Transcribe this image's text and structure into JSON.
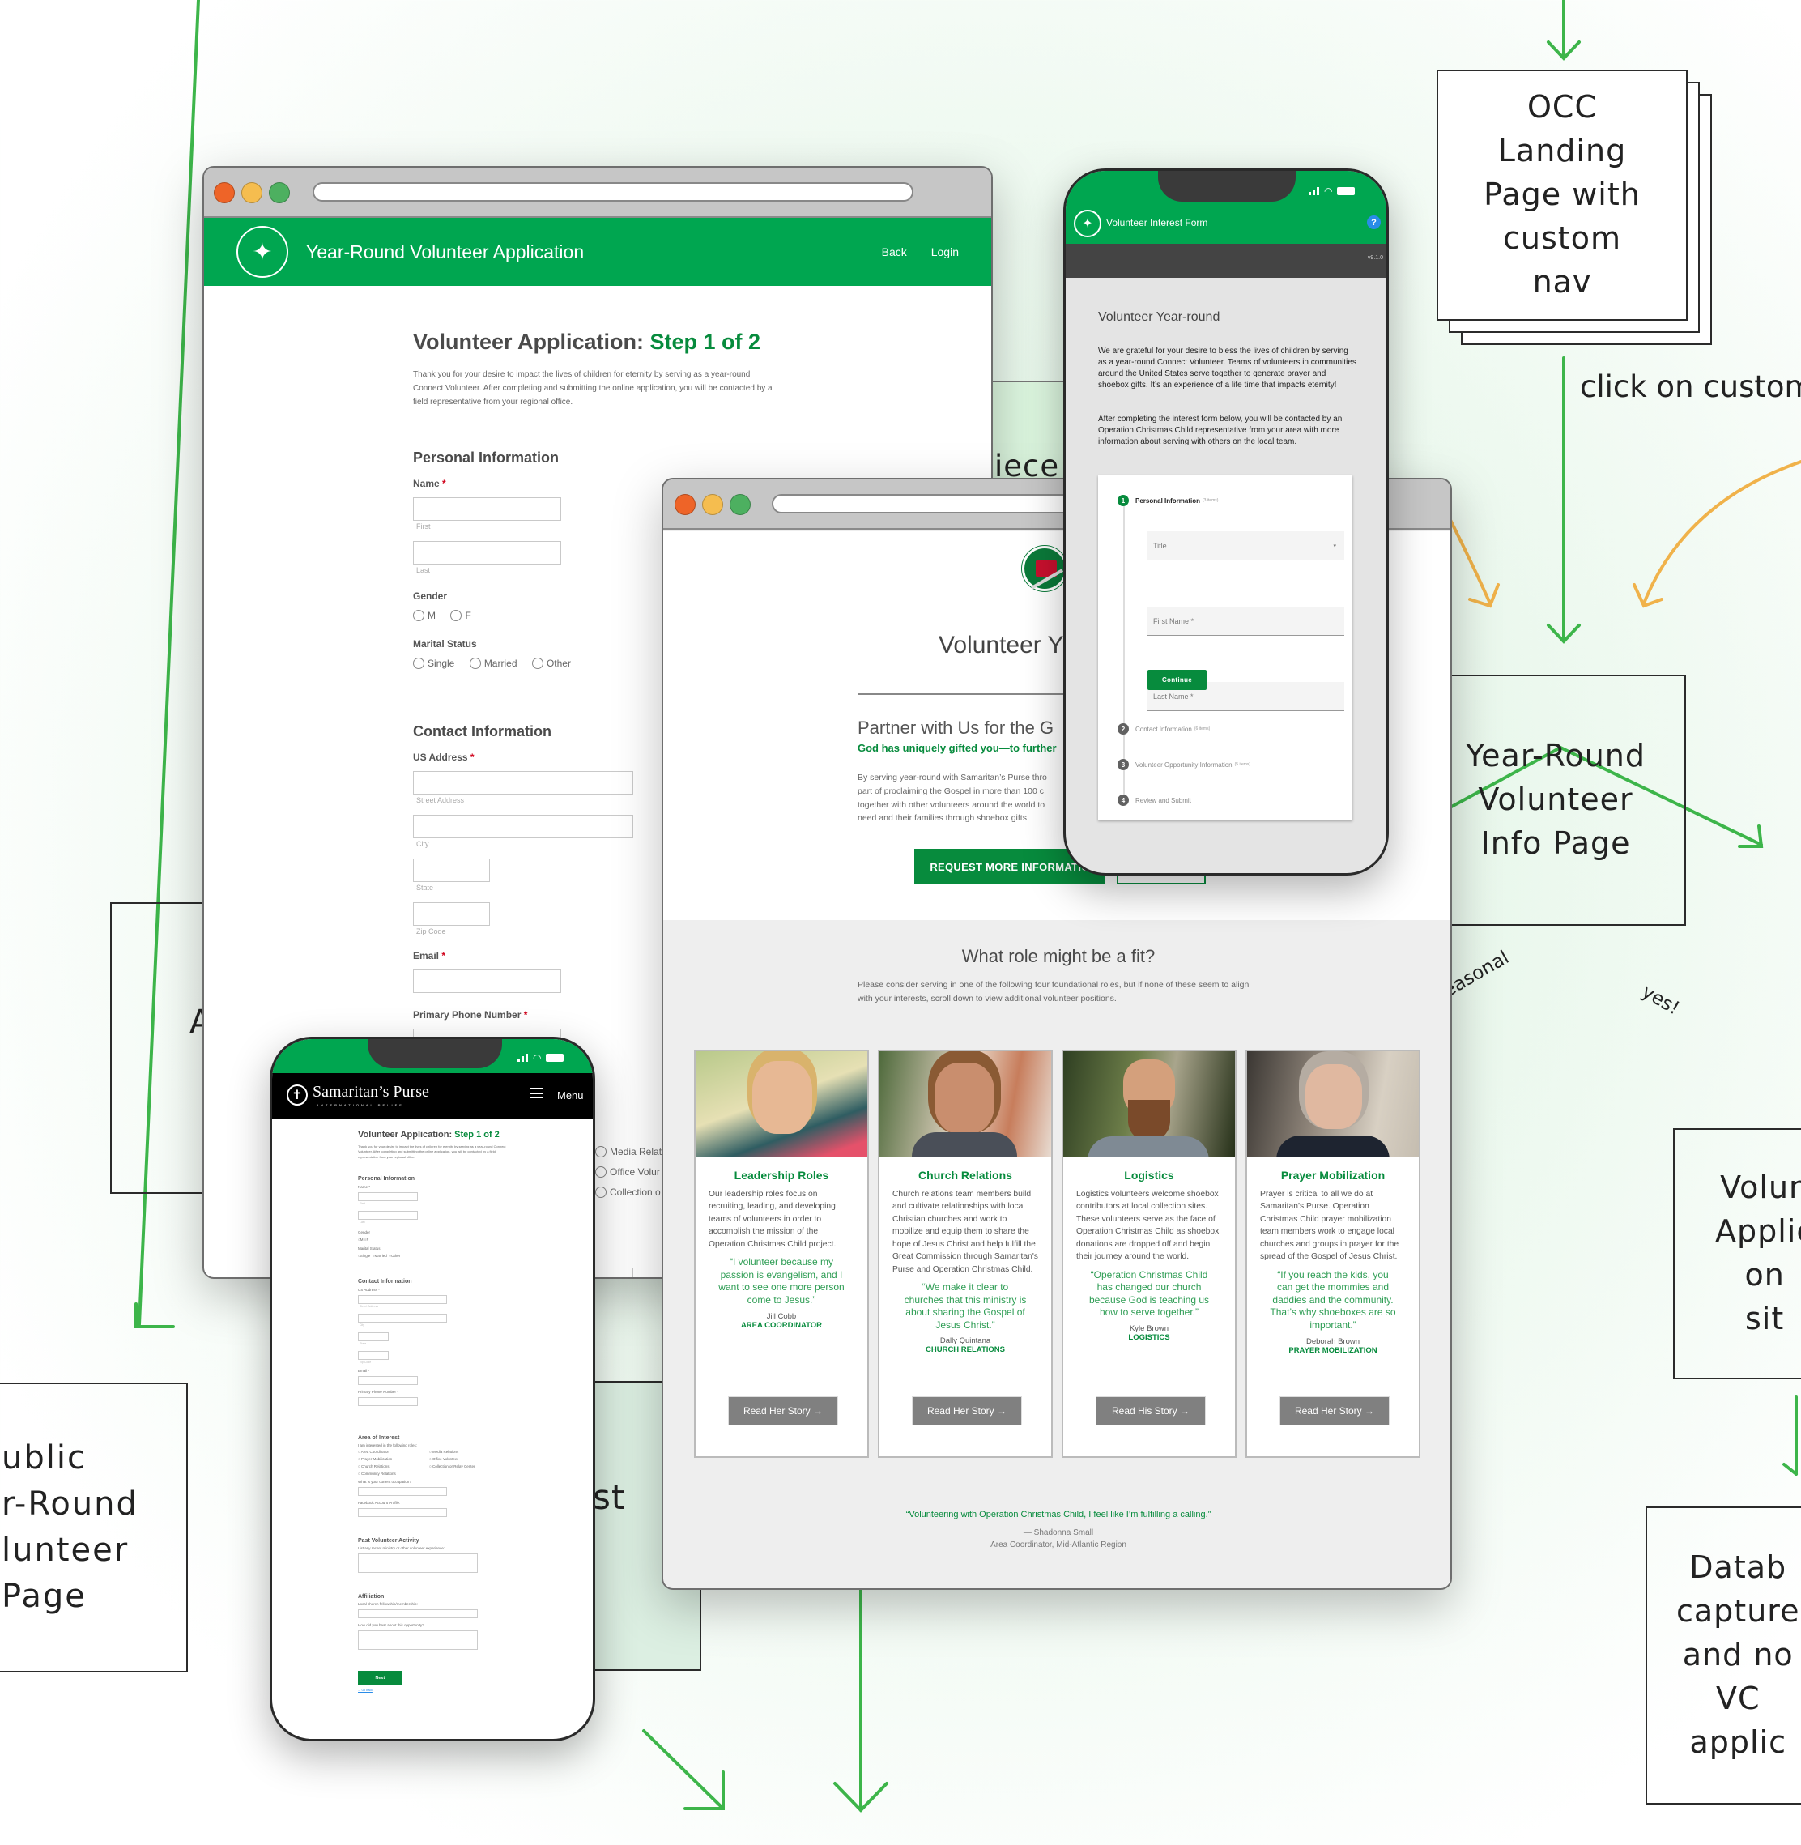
{
  "flow": {
    "occ_landing": "OCC\nLanding\nPage with\ncustom\nnav",
    "click_label": "click on custom",
    "info_page": "Year-Round\nVolunteer\nInfo Page",
    "branch_seasonal": "easonal",
    "branch_yes": "yes!",
    "vol_app_site": "Volun\nApplic\non \nsit",
    "database": "Datab\ncapture\nand no\nVC \napplic",
    "public_page": "ublic\nr-Round\nlunteer\nPage",
    "hidden_box_letters": "A",
    "hidden_box_2": "st",
    "piece_label": "iece",
    "colors": {
      "green_arrow": "#3db54a",
      "orange_arrow": "#f0b24a"
    }
  },
  "desktop_app": {
    "header_title": "Year-Round Volunteer Application",
    "nav": [
      "Back",
      "Login"
    ],
    "heading_prefix": "Volunteer Application: ",
    "heading_step": "Step 1 of 2",
    "intro": "Thank you for your desire to impact the lives of children for eternity by serving as a year-round Connect Volunteer. After completing and submitting the online application, you will be contacted by a field representative from your regional office.",
    "personal": {
      "title": "Personal Information",
      "name_label": "Name",
      "first_sub": "First",
      "last_sub": "Last",
      "gender_label": "Gender",
      "gender_options": [
        "M",
        "F"
      ],
      "marital_label": "Marital Status",
      "marital_options": [
        "Single",
        "Married",
        "Other"
      ]
    },
    "contact": {
      "title": "Contact Information",
      "address_label": "US Address",
      "street_sub": "Street Address",
      "city_sub": "City",
      "state_sub": "State",
      "zip_sub": "Zip Code",
      "email_label": "Email",
      "phone_label": "Primary Phone Number"
    },
    "interest_partial": [
      "Media Relat",
      "Office Volur",
      "Collection o"
    ],
    "required_mark": "*"
  },
  "info_page": {
    "heading": "Volunteer Y",
    "partner_title": "Partner with Us for the G",
    "partner_sub": "God has uniquely gifted you—to further",
    "body": "By serving year-round with Samaritan’s Purse thro\npart of proclaiming the Gospel in more than 100 c\ntogether with other volunteers around the world to\nneed and their families through shoebox gifts.",
    "cta": "REQUEST MORE INFORMATIO",
    "roles_title": "What role might be a fit?",
    "roles_intro": "Please consider serving in one of the following four foundational roles, but if none of these seem to align with your interests, scroll down to view additional volunteer positions.",
    "roles": [
      {
        "title": "Leadership Roles",
        "desc": "Our leadership roles focus on recruiting, leading, and developing teams of volunteers in order to accomplish the mission of the Operation Christmas Child project.",
        "quote": "“I volunteer because my passion is evangelism, and I want to see one more person come to Jesus.”",
        "name": "Jill Cobb",
        "role": "AREA COORDINATOR",
        "button": "Read Her Story →"
      },
      {
        "title": "Church Relations",
        "desc": "Church relations team members build and cultivate relationships with local Christian churches and work to mobilize and equip them to share the hope of Jesus Christ and help fulfill the Great Commission through Samaritan's Purse and Operation Christmas Child.",
        "quote": "“We make it clear to churches that this ministry is about sharing the Gospel of Jesus Christ.”",
        "name": "Dally Quintana",
        "role": "CHURCH RELATIONS",
        "button": "Read Her Story →"
      },
      {
        "title": "Logistics",
        "desc": "Logistics volunteers welcome shoebox contributors at local collection sites. These volunteers serve as the face of Operation Christmas Child as shoebox donations are dropped off and begin their journey around the world.",
        "quote": "“Operation Christmas Child has changed our church because God is teaching us how to serve together.”",
        "name": "Kyle Brown",
        "role": "LOGISTICS",
        "button": "Read His Story →"
      },
      {
        "title": "Prayer Mobilization",
        "desc": "Prayer is critical to all we do at Samaritan’s Purse. Operation Christmas Child prayer mobilization team members work to engage local churches and groups in prayer for the spread of the Gospel of Jesus Christ.",
        "quote": "“If you reach the kids, you can get the mommies and daddies and the community. That’s why shoeboxes are so important.”",
        "name": "Deborah Brown",
        "role": "PRAYER MOBILIZATION",
        "button": "Read Her Story →"
      }
    ],
    "testimonial": "“Volunteering with Operation Christmas Child, I feel like I’m fulfilling a calling.”",
    "testimonial_name": "— Shadonna Small",
    "testimonial_role": "Area Coordinator, Mid-Atlantic Region"
  },
  "interest_phone": {
    "header_title": "Volunteer Interest Form",
    "version": "v9.1.0",
    "heading": "Volunteer Year-round",
    "para1": "We are grateful for your desire to bless the lives of children by serving as a year-round Connect Volunteer. Teams of volunteers in communities around the United States serve together to generate prayer and shoebox gifts. It’s an experience of a life time that impacts eternity!",
    "para2": "After completing the interest form below, you will be contacted by an Operation Christmas Child representative from your area with more information about serving with others on the local team.",
    "steps": [
      {
        "num": "1",
        "label": "Personal Information",
        "count": "(3 items)"
      },
      {
        "num": "2",
        "label": "Contact Information",
        "count": "(6 items)"
      },
      {
        "num": "3",
        "label": "Volunteer Opportunity Information",
        "count": "(5 items)"
      },
      {
        "num": "4",
        "label": "Review and Submit",
        "count": ""
      }
    ],
    "fields": {
      "title": "Title",
      "first_name": "First Name *",
      "last_name": "Last Name *"
    },
    "continue": "Continue"
  },
  "mobile_app": {
    "brand": "Samaritan’s Purse",
    "brand_sub": "INTERNATIONAL RELIEF",
    "menu": "Menu",
    "heading_prefix": "Volunteer Application: ",
    "heading_step": "Step 1 of 2",
    "intro": "Thank you for your desire to impact the lives of children for eternity by serving as a year-round Connect Volunteer. After completing and submitting the online application, you will be contacted by a field representative from your regional office.",
    "personal_title": "Personal Information",
    "name_label": "Name *",
    "first": "First",
    "last": "Last",
    "gender_label": "Gender",
    "gender_options": [
      "M",
      "F"
    ],
    "marital_label": "Marital Status",
    "marital_options": [
      "Single",
      "Married",
      "Other"
    ],
    "contact_title": "Contact Information",
    "address_label": "US Address *",
    "street": "Street Address",
    "city": "City",
    "state": "State",
    "zip": "Zip Code",
    "email_label": "Email *",
    "phone_label": "Primary Phone Number *",
    "interest_title": "Area of Interest",
    "interest_intro": "I am interested in the following roles:",
    "interest_options_left": [
      "Area Coordinator",
      "Prayer Mobilization",
      "Church Relations",
      "Community Relations"
    ],
    "interest_options_right": [
      "Media Relations",
      "Office Volunteer",
      "Collection or Relay Center"
    ],
    "occupation_label": "What is your current occupation?",
    "facebook_label": "Facebook Account Profile:",
    "past_title": "Past Volunteer Activity",
    "past_label": "List any recent ministry or other volunteer experience:",
    "affiliation_title": "Affiliation",
    "church_label": "Local church fellowship/membership:",
    "hear_label": "How did you hear about this opportunity?",
    "next": "Next",
    "go_back": "← Go Back"
  }
}
